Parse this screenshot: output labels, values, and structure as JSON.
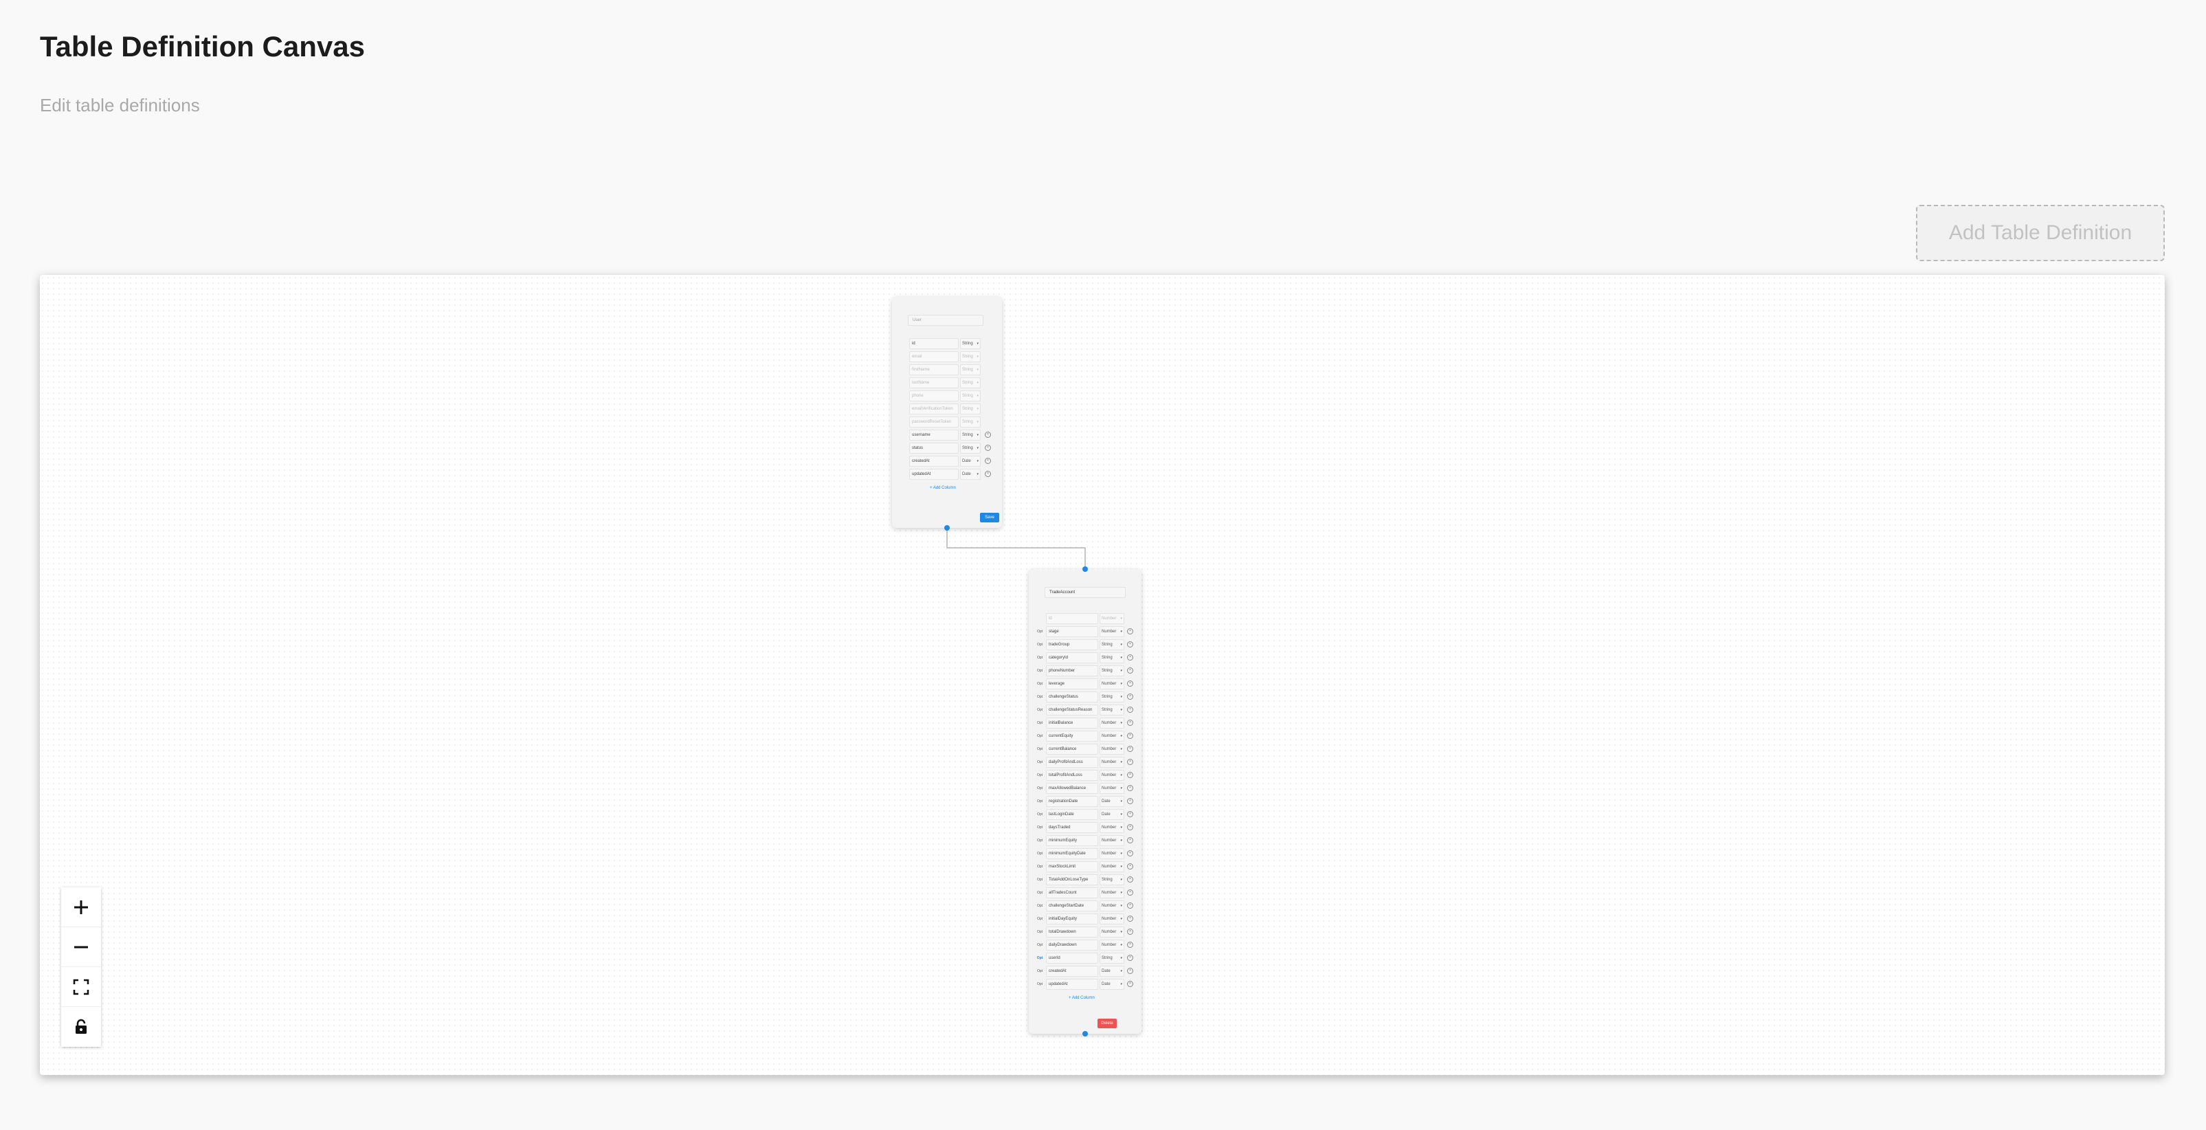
{
  "header": {
    "title": "Table Definition Canvas",
    "subtitle": "Edit table definitions"
  },
  "toolbar": {
    "add_table_label": "Add Table Definition"
  },
  "nodes": [
    {
      "name_placeholder": "User",
      "name_value": "",
      "columns": [
        {
          "name": "id",
          "type": "String",
          "deletable": false,
          "faded": false
        },
        {
          "name": "email",
          "type": "String",
          "deletable": false,
          "faded": true
        },
        {
          "name": "firstName",
          "type": "String",
          "deletable": false,
          "faded": true
        },
        {
          "name": "lastName",
          "type": "String",
          "deletable": false,
          "faded": true
        },
        {
          "name": "phone",
          "type": "String",
          "deletable": false,
          "faded": true
        },
        {
          "name": "emailVerificationToken",
          "type": "String",
          "deletable": false,
          "faded": true
        },
        {
          "name": "passwordResetToken",
          "type": "String",
          "deletable": false,
          "faded": true
        },
        {
          "name": "username",
          "type": "String",
          "deletable": true,
          "faded": false
        },
        {
          "name": "status",
          "type": "String",
          "deletable": true,
          "faded": false
        },
        {
          "name": "createdAt",
          "type": "Date",
          "deletable": true,
          "faded": false
        },
        {
          "name": "updatedAt",
          "type": "Date",
          "deletable": true,
          "faded": false
        }
      ],
      "add_column_label": "+ Add Column",
      "save_label": "Save"
    },
    {
      "name_placeholder": "",
      "name_value": "TradeAccount",
      "columns": [
        {
          "name": "id",
          "type": "Number",
          "pk": "",
          "deletable": false,
          "faded": true
        },
        {
          "name": "stage",
          "type": "Number",
          "pk": "Opt",
          "deletable": true,
          "faded": false
        },
        {
          "name": "tradeGroup",
          "type": "String",
          "pk": "Opt",
          "deletable": true,
          "faded": false
        },
        {
          "name": "categoryId",
          "type": "String",
          "pk": "Opt",
          "deletable": true,
          "faded": false
        },
        {
          "name": "phoneNumber",
          "type": "String",
          "pk": "Opt",
          "deletable": true,
          "faded": false
        },
        {
          "name": "leverage",
          "type": "Number",
          "pk": "Opt",
          "deletable": true,
          "faded": false
        },
        {
          "name": "challengeStatus",
          "type": "String",
          "pk": "Opt",
          "deletable": true,
          "faded": false
        },
        {
          "name": "challengeStatusReason",
          "type": "String",
          "pk": "Opt",
          "deletable": true,
          "faded": false
        },
        {
          "name": "initialBalance",
          "type": "Number",
          "pk": "Opt",
          "deletable": true,
          "faded": false
        },
        {
          "name": "currentEquity",
          "type": "Number",
          "pk": "Opt",
          "deletable": true,
          "faded": false
        },
        {
          "name": "currentBalance",
          "type": "Number",
          "pk": "Opt",
          "deletable": true,
          "faded": false
        },
        {
          "name": "dailyProfitAndLoss",
          "type": "Number",
          "pk": "Opt",
          "deletable": true,
          "faded": false
        },
        {
          "name": "totalProfitAndLoss",
          "type": "Number",
          "pk": "Opt",
          "deletable": true,
          "faded": false
        },
        {
          "name": "maxAllowedBalance",
          "type": "Number",
          "pk": "Opt",
          "deletable": true,
          "faded": false
        },
        {
          "name": "registrationDate",
          "type": "Date",
          "pk": "Opt",
          "deletable": true,
          "faded": false
        },
        {
          "name": "lastLoginDate",
          "type": "Date",
          "pk": "Opt",
          "deletable": true,
          "faded": false
        },
        {
          "name": "daysTraded",
          "type": "Number",
          "pk": "Opt",
          "deletable": true,
          "faded": false
        },
        {
          "name": "minimumEquity",
          "type": "Number",
          "pk": "Opt",
          "deletable": true,
          "faded": false
        },
        {
          "name": "minimumEquityDate",
          "type": "Number",
          "pk": "Opt",
          "deletable": true,
          "faded": false
        },
        {
          "name": "maxStockLimit",
          "type": "Number",
          "pk": "Opt",
          "deletable": true,
          "faded": false
        },
        {
          "name": "TotalAddOnLoseType",
          "type": "String",
          "pk": "Opt",
          "deletable": true,
          "faded": false
        },
        {
          "name": "allTradesCount",
          "type": "Number",
          "pk": "Opt",
          "deletable": true,
          "faded": false
        },
        {
          "name": "challengeStartDate",
          "type": "Number",
          "pk": "Opt",
          "deletable": true,
          "faded": false
        },
        {
          "name": "initialDayEquity",
          "type": "Number",
          "pk": "Opt",
          "deletable": true,
          "faded": false
        },
        {
          "name": "totalDrawdown",
          "type": "Number",
          "pk": "Opt",
          "deletable": true,
          "faded": false
        },
        {
          "name": "dailyDrawdown",
          "type": "Number",
          "pk": "Opt",
          "deletable": true,
          "faded": false
        },
        {
          "name": "userId",
          "type": "String",
          "pk": "Opt",
          "pk_active": true,
          "deletable": true,
          "faded": false
        },
        {
          "name": "createdAt",
          "type": "Date",
          "pk": "Opt",
          "deletable": true,
          "faded": false
        },
        {
          "name": "updatedAt",
          "type": "Date",
          "pk": "Opt",
          "deletable": true,
          "faded": false
        }
      ],
      "add_column_label": "+ Add Column",
      "delete_label": "Delete"
    }
  ],
  "colors": {
    "accent": "#1e88e5",
    "danger": "#ef5350",
    "background": "#f9f9f9"
  },
  "controls": [
    {
      "name": "zoom-in",
      "icon": "plus-icon"
    },
    {
      "name": "zoom-out",
      "icon": "minus-icon"
    },
    {
      "name": "fit-view",
      "icon": "fit-view-icon"
    },
    {
      "name": "lock",
      "icon": "lock-icon"
    }
  ]
}
